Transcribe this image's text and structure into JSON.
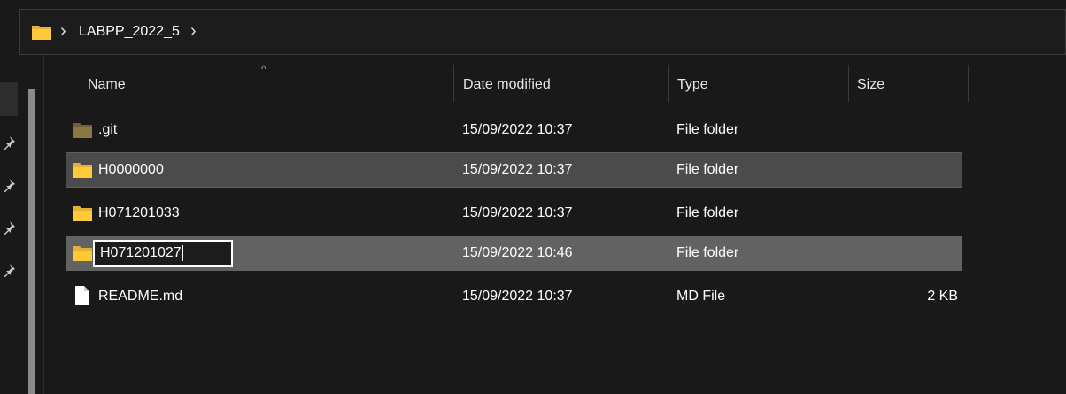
{
  "address": {
    "crumbs": [
      "LABPP_2022_5"
    ]
  },
  "columns": {
    "name": "Name",
    "date": "Date modified",
    "type": "Type",
    "size": "Size"
  },
  "rows": [
    {
      "name": ".git",
      "date": "15/09/2022 10:37",
      "type": "File folder",
      "size": "",
      "icon": "folder-icon-dim"
    },
    {
      "name": "H0000000",
      "date": "15/09/2022 10:37",
      "type": "File folder",
      "size": "",
      "icon": "folder-icon"
    },
    {
      "name": "H071201033",
      "date": "15/09/2022 10:37",
      "type": "File folder",
      "size": "",
      "icon": "folder-icon"
    },
    {
      "name": "H071201027",
      "date": "15/09/2022 10:46",
      "type": "File folder",
      "size": "",
      "icon": "folder-icon"
    },
    {
      "name": "README.md",
      "date": "15/09/2022 10:37",
      "type": "MD File",
      "size": "2 KB",
      "icon": "file-icon"
    }
  ],
  "colors": {
    "folder": "#ffca3a",
    "folder_dim": "#8a7741",
    "selected_row": "#4b4b4b",
    "editing_row": "#626262"
  }
}
